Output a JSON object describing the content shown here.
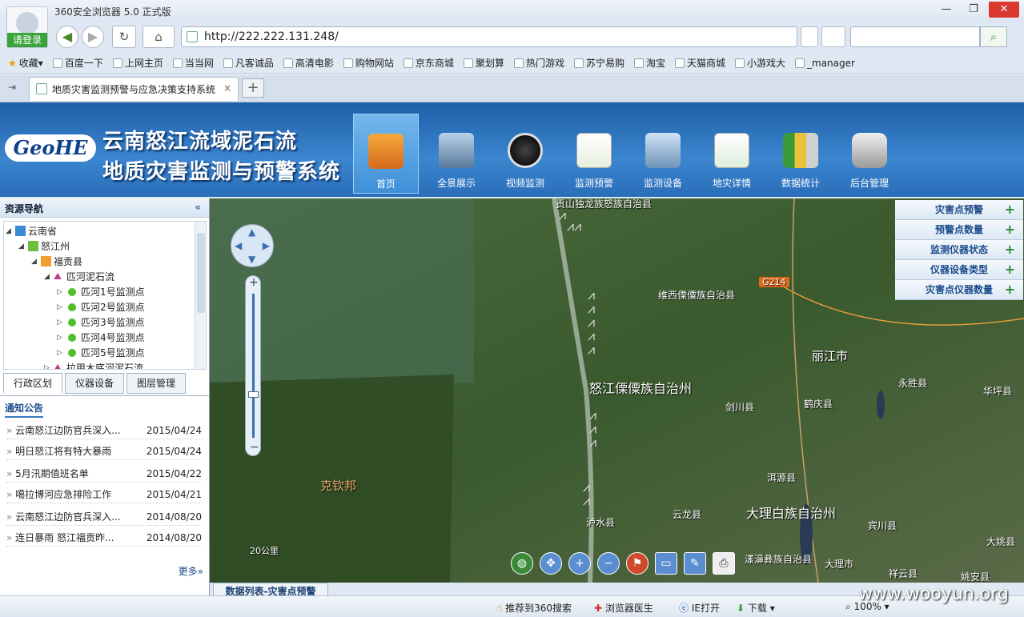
{
  "window": {
    "title": "360安全浏览器 5.0 正式版",
    "login": "请登录",
    "min": "—",
    "max": "❐",
    "close": "✕"
  },
  "nav": {
    "url": "http://222.222.131.248/",
    "back": "◀",
    "forward": "▶",
    "refresh": "↻",
    "home": "⌂"
  },
  "favorites": [
    "收藏",
    "百度一下",
    "上网主页",
    "当当网",
    "凡客诚品",
    "高清电影",
    "购物网站",
    "京东商城",
    "聚划算",
    "热门游戏",
    "苏宁易购",
    "淘宝",
    "天猫商城",
    "小游戏大",
    "_manager"
  ],
  "tab": {
    "label": "地质灾害监测预警与应急决策支持系统",
    "close": "×"
  },
  "header": {
    "logo": "GeoHE",
    "title1": "云南怒江流域泥石流",
    "title2": "地质灾害监测与预警系统",
    "menu": [
      "首页",
      "全景展示",
      "视频监测",
      "监测预警",
      "监测设备",
      "地灾详情",
      "数据统计",
      "后台管理"
    ]
  },
  "sidebar": {
    "title": "资源导航",
    "tree": [
      "云南省",
      "怒江州",
      "福贡县",
      "匹河泥石流",
      "匹河1号监测点",
      "匹河2号监测点",
      "匹河3号监测点",
      "匹河4号监测点",
      "匹河5号监测点",
      "拉甲木底河泥石流"
    ],
    "tabs": [
      "行政区划",
      "仪器设备",
      "图层管理"
    ],
    "notice_title": "通知公告",
    "notices": [
      {
        "title": "云南怒江边防官兵深入...",
        "date": "2015/04/24"
      },
      {
        "title": "明日怒江将有特大暴雨",
        "date": "2015/04/24"
      },
      {
        "title": "5月汛期值班名单",
        "date": "2015/04/22"
      },
      {
        "title": "噶拉博河应急排险工作",
        "date": "2015/04/21"
      },
      {
        "title": "云南怒江边防官兵深入...",
        "date": "2014/08/20"
      },
      {
        "title": "连日暴雨 怒江福贡昨...",
        "date": "2014/08/20"
      }
    ],
    "more": "更多»"
  },
  "map": {
    "labels": [
      "贡山独龙族怒族自治县",
      "维西傈僳族自治县",
      "丽江市",
      "永胜县",
      "华坪县",
      "怒江傈僳族自治州",
      "剑川县",
      "鹤庆县",
      "洱源县",
      "克钦邦",
      "云龙县",
      "泸水县",
      "大理白族自治州",
      "宾川县",
      "漾濞彝族自治县",
      "大理市",
      "祥云县",
      "大姚县",
      "G214",
      "公里",
      "姚安县"
    ],
    "scale": "20公里"
  },
  "rpanel": [
    "灾害点预警",
    "预警点数量",
    "监测仪器状态",
    "仪器设备类型",
    "灾害点仪器数量"
  ],
  "datatab": "数据列表-灾害点预警",
  "status": {
    "s1": "推荐到360搜索",
    "s2": "浏览器医生",
    "s3": "IE打开",
    "s4": "下载",
    "zoom": "100%"
  },
  "watermark": "www.wooyun.org",
  "chart_data": {
    "type": "map",
    "title": "云南怒江流域泥石流地质灾害监测与预警系统"
  }
}
